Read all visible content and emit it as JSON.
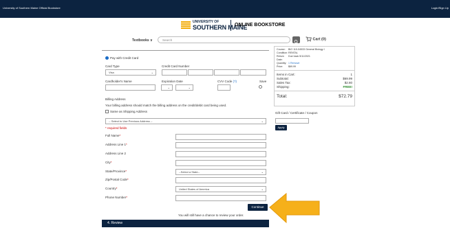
{
  "topbar": {
    "store_name": "University of Southern Maine Official Bookstore",
    "login": "Login/Sign Up"
  },
  "brand": {
    "line1": "UNIVERSITY OF",
    "line2": "SOUTHERN MAINE",
    "store": "ONLINE BOOKSTORE",
    "accent": "#f2a900",
    "navy": "#0c2340"
  },
  "nav": {
    "textbooks": "Textbooks ∨",
    "search_placeholder": "Search",
    "cart": "Cart (0)"
  },
  "payment": {
    "pay_option": "Pay with Credit Card",
    "card_type_label": "Card Type",
    "card_type_value": "Visa",
    "card_number_label": "Credit Card Number",
    "cardholder_label": "Cardholder's Name",
    "expiration_label": "Expiration Date",
    "cvv_label": "CVV Code",
    "cvv_help": "(?)",
    "save_label": "Save"
  },
  "billing": {
    "title": "Billing Address",
    "note": "Your billing address should match the billing address on the credit/debit card being used.",
    "same_as_shipping": "Same as Shipping Address",
    "previous_address": "-- Select to Use Previous Address --",
    "required_note": "* required fields",
    "fields": {
      "full_name": "Full Name",
      "address1": "Address Line 1",
      "address2": "Address Line 2",
      "city": "City",
      "state": "State/Province",
      "zip": "Zip/Postal Code",
      "country": "Country",
      "phone": "Phone Number"
    },
    "state_value": "--Select a State--",
    "country_value": "United States of America",
    "asterisk": "*"
  },
  "actions": {
    "continue": "Continue",
    "review_note": "You will still have a chance to review your order.",
    "next_step": "4. Review"
  },
  "summary": {
    "course_label": "Course:",
    "course_value": "BIO 110-04533 General Biology I",
    "condition_label": "Condition:",
    "condition_value": "RENTAL",
    "return_label": "Return",
    "return_value": "Due back 5/11/2021",
    "date_label": "Date:",
    "quantity_label": "Quantity:",
    "quantity_value": "1 Remove",
    "price_label": "Price:",
    "price_value": "$69.99",
    "items_label": "Items in Cart:",
    "items_value": "1",
    "subtotal_label": "Subtotal:",
    "subtotal_value": "$69.99",
    "tax_label": "Sales Tax:",
    "tax_value": "$2.80",
    "shipping_label": "Shipping:",
    "shipping_value": "FREE!",
    "total_label": "Total:",
    "total_value": "$72.79"
  },
  "gift": {
    "label": "Gift Card / Certificate / Coupon",
    "apply": "Apply"
  }
}
